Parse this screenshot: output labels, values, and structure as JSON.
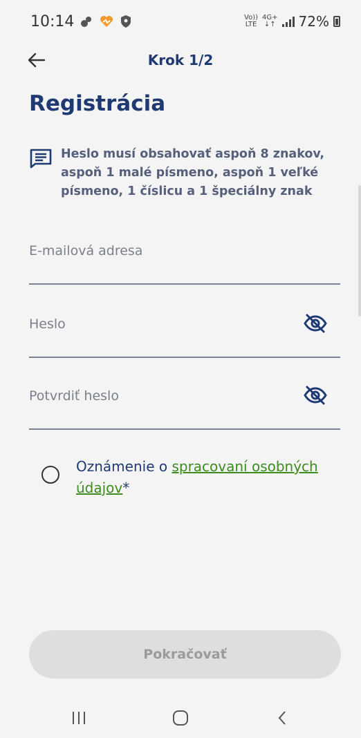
{
  "status_bar": {
    "time": "10:14",
    "net_top": "Vo))",
    "net_bottom": "LTE",
    "net2_top": "4G+",
    "net2_bottom": "↓↑",
    "battery": "72%"
  },
  "header": {
    "step": "Krok 1/2"
  },
  "page": {
    "title": "Registrácia",
    "hint": "Heslo musí obsahovať aspoň 8 znakov, aspoň 1 malé písmeno, aspoň 1 veľké písmeno, 1 číslicu a 1 špeciálny znak"
  },
  "form": {
    "email": {
      "placeholder": "E-mailová adresa",
      "value": ""
    },
    "password": {
      "placeholder": "Heslo",
      "value": ""
    },
    "confirm_password": {
      "placeholder": "Potvrdiť heslo",
      "value": ""
    },
    "consent": {
      "prefix": "Oznámenie o ",
      "link": "spracovaní osobných údajov",
      "suffix": "*"
    },
    "continue_label": "Pokračovať"
  },
  "icons": {
    "back": "arrow-left-icon",
    "hint": "message-icon",
    "eye": "eye-off-icon"
  },
  "colors": {
    "primary": "#1f3a73",
    "link": "#3c8c1e",
    "button_disabled": "#dedede"
  }
}
